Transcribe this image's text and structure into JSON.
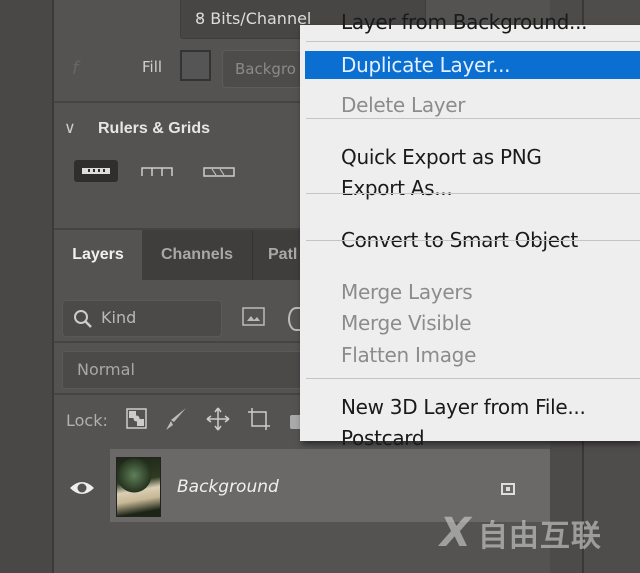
{
  "properties": {
    "bit_depth": "8 Bits/Channel",
    "fill_label": "Fill",
    "fill_field": "Backgro"
  },
  "rulers_grids": {
    "title": "Rulers & Grids"
  },
  "layers_panel": {
    "tabs": [
      {
        "label": "Layers",
        "active": true
      },
      {
        "label": "Channels"
      },
      {
        "label": "Patl"
      }
    ],
    "filter_placeholder": "Kind",
    "blend_mode": "Normal",
    "lock_label": "Lock:",
    "layers": [
      {
        "name": "Background",
        "visible": true
      }
    ]
  },
  "context_menu": {
    "highlight_color": "#0a6fd1",
    "items": [
      {
        "label": "Layer from Background...",
        "enabled": true
      },
      {
        "label": "Duplicate Layer...",
        "enabled": true,
        "highlighted": true
      },
      {
        "label": "Delete Layer",
        "enabled": false
      },
      {
        "label": "Quick Export as PNG",
        "enabled": true
      },
      {
        "label": "Export As...",
        "enabled": true
      },
      {
        "label": "Convert to Smart Object",
        "enabled": true
      },
      {
        "label": "Merge Layers",
        "enabled": false
      },
      {
        "label": "Merge Visible",
        "enabled": false
      },
      {
        "label": "Flatten Image",
        "enabled": false
      },
      {
        "label": "New 3D Layer from File...",
        "enabled": true
      },
      {
        "label": "Postcard",
        "enabled": true
      }
    ]
  },
  "watermark": {
    "text": "自由互联"
  }
}
